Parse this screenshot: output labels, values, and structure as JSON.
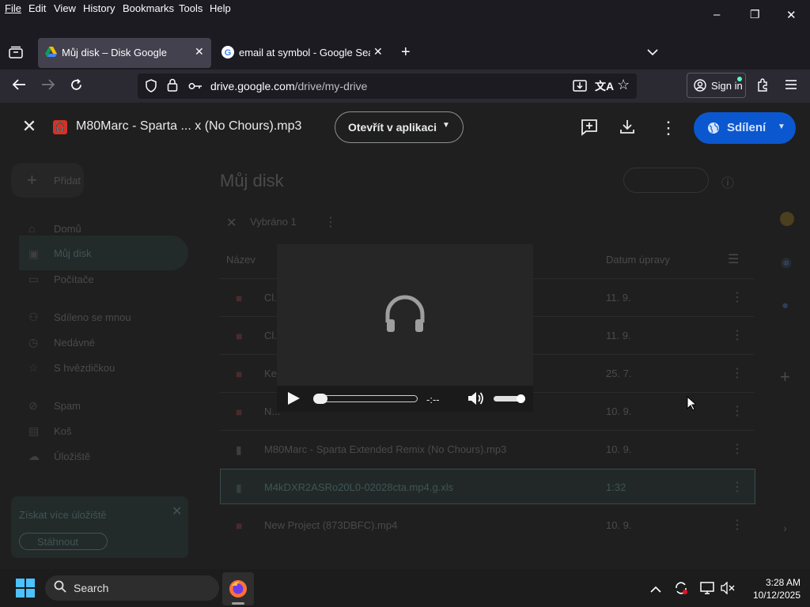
{
  "menu": [
    "File",
    "Edit",
    "View",
    "History",
    "Bookmarks",
    "Tools",
    "Help"
  ],
  "window_controls": {
    "minimize": "–",
    "restore": "❐",
    "close": "✕"
  },
  "tabs": [
    {
      "title": "Můj disk – Disk Google",
      "active": true
    },
    {
      "title": "email at symbol - Google Search",
      "active": false
    }
  ],
  "new_tab": "+",
  "url": {
    "host": "drive.google.com",
    "path": "/drive/my-drive"
  },
  "sign_in": "Sign in",
  "viewer": {
    "file_name": "M80Marc - Sparta ... x (No Chours).mp3",
    "open_in_app": "Otevřít v aplikaci",
    "share": "Sdílení"
  },
  "player": {
    "time": "-:--"
  },
  "drive_bg": {
    "new_button": "Přidat",
    "title": "Můj disk",
    "selected": "Vybráno 1",
    "col_name": "Název",
    "col_modified": "Datum úpravy",
    "nav": [
      "Domů",
      "Můj disk",
      "Počítače",
      "Sdíleno se mnou",
      "Nedávné",
      "S hvězdičkou",
      "Spam",
      "Koš",
      "Úložiště"
    ],
    "rows": [
      {
        "name": "Cl...",
        "date": "11. 9."
      },
      {
        "name": "Cl...",
        "date": "11. 9."
      },
      {
        "name": "Ke...",
        "date": "25. 7."
      },
      {
        "name": "N...",
        "date": "10. 9."
      },
      {
        "name": "M80Marc - Sparta Extended Remix (No Chours).mp3",
        "date": "10. 9."
      },
      {
        "name": "M4kDXR2ASRo20L0-02028cta.mp4.g.xls",
        "date": "1:32"
      },
      {
        "name": "New Project (873DBFC).mp4",
        "date": "10. 9."
      }
    ],
    "storage_text": "Získat více úložiště",
    "storage_button": "Stáhnout"
  },
  "taskbar": {
    "search": "Search",
    "time": "3:28 AM",
    "date": "10/12/2025"
  }
}
